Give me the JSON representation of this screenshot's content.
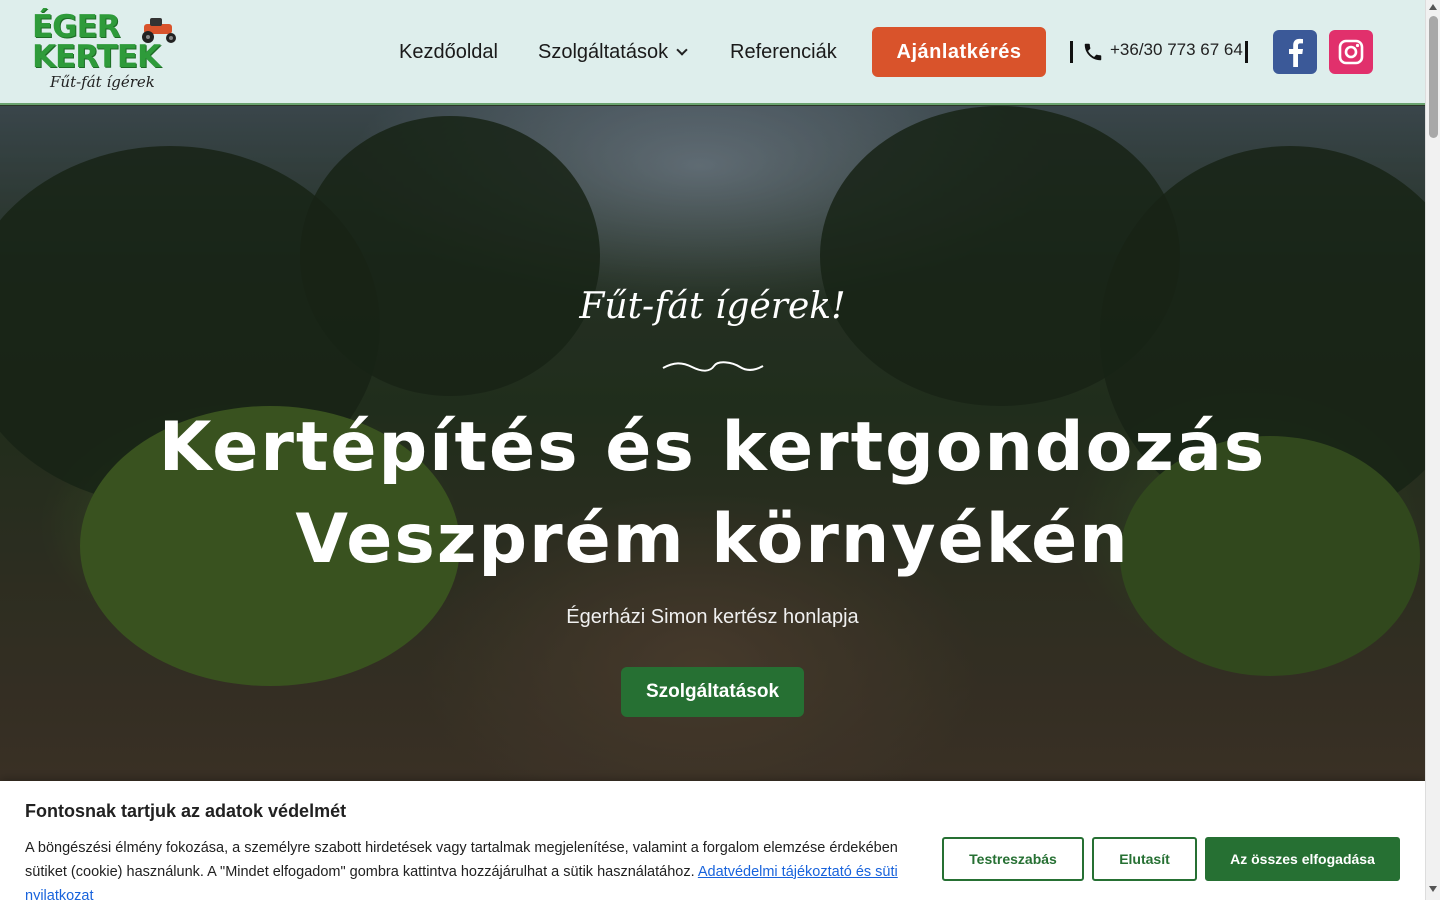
{
  "header": {
    "logo": {
      "line1": "ÉGER",
      "line2": "KERTEK",
      "tagline": "Fűt-fát ígérek"
    },
    "nav": {
      "home": "Kezdőoldal",
      "services": "Szolgáltatások",
      "references": "Referenciák"
    },
    "quote_button": "Ajánlatkérés",
    "phone": "+36/30 773 67 64",
    "social": {
      "facebook_icon": "facebook-icon",
      "instagram_icon": "instagram-icon"
    },
    "colors": {
      "background": "#deeeec",
      "quote_button": "#d9532b",
      "facebook": "#3b5998",
      "instagram": "#e1306c"
    }
  },
  "hero": {
    "script_line": "Fűt-fát ígérek!",
    "title_line1": "Kertépítés és kertgondozás",
    "title_line2": "Veszprém környékén",
    "subtitle": "Égerházi Simon kertész honlapja",
    "cta_button": "Szolgáltatások",
    "colors": {
      "cta": "#267033"
    }
  },
  "cookie_banner": {
    "title": "Fontosnak tartjuk az adatok védelmét",
    "text": "A böngészési élmény fokozása, a személyre szabott hirdetések vagy tartalmak megjelenítése, valamint a forgalom elemzése érdekében sütiket (cookie) használunk. A \"Mindet elfogadom\" gombra kattintva hozzájárulhat a sütik használatához.",
    "link": "Adatvédelmi tájékoztató és süti nyilatkozat",
    "buttons": {
      "customize": "Testreszabás",
      "reject": "Elutasít",
      "accept_all": "Az összes elfogadása"
    },
    "colors": {
      "accent": "#267033",
      "link": "#1863dc"
    }
  }
}
